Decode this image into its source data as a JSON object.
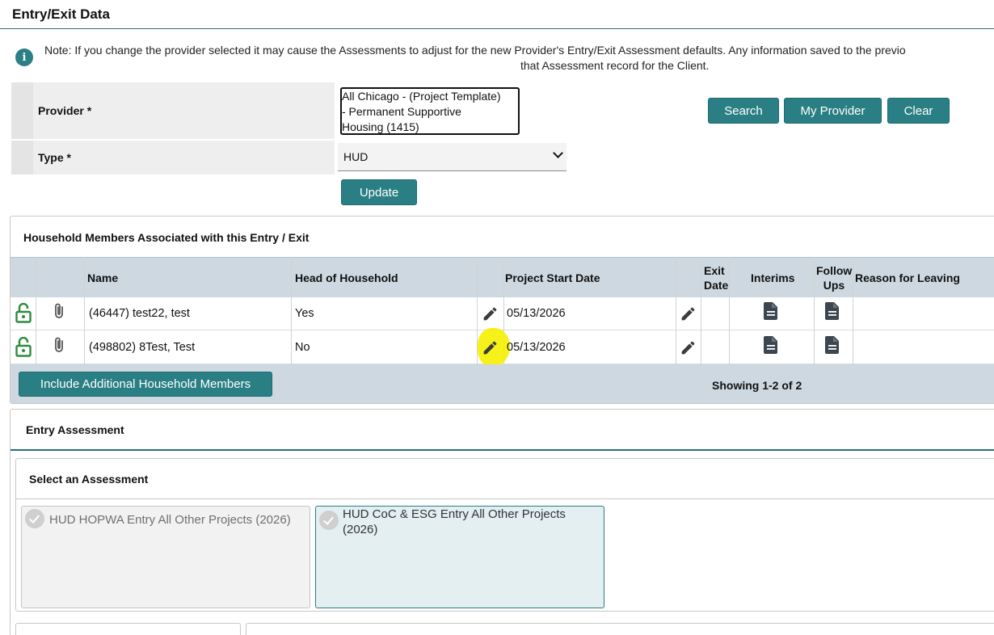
{
  "page": {
    "title": "Entry/Exit Data",
    "note_line1": "Note: If you change the provider selected it may cause the Assessments to adjust for the new Provider's Entry/Exit Assessment defaults. Any information saved to the previo",
    "note_line2": "that Assessment record for the Client.",
    "note_icon": "info-icon"
  },
  "form": {
    "provider_label": "Provider *",
    "provider_value_lines": [
      "All Chicago - (Project Template)",
      "- Permanent Supportive",
      "Housing (1415)"
    ],
    "type_label": "Type *",
    "type_value": "HUD",
    "update_label": "Update",
    "search_label": "Search",
    "my_provider_label": "My Provider",
    "clear_label": "Clear"
  },
  "household": {
    "title": "Household Members Associated with this Entry / Exit",
    "columns": {
      "name": "Name",
      "head": "Head of Household",
      "start": "Project Start Date",
      "exit_line1": "Exit",
      "exit_line2": "Date",
      "interims": "Interims",
      "follow_line1": "Follow",
      "follow_line2": "Ups",
      "reason": "Reason for Leaving"
    },
    "rows": [
      {
        "name": "(46447) test22, test",
        "head": "Yes",
        "start": "05/13/2026"
      },
      {
        "name": "(498802) 8Test, Test",
        "head": "No",
        "start": "05/13/2026"
      }
    ],
    "include_label": "Include Additional Household Members",
    "showing": "Showing 1-2 of 2"
  },
  "entry": {
    "title": "Entry Assessment",
    "select_title": "Select an Assessment",
    "cards": [
      {
        "label_line1": "HUD HOPWA Entry All Other Projects (2026)",
        "label_line2": "",
        "selected": false
      },
      {
        "label_line1": "HUD CoC & ESG Entry All Other Projects",
        "label_line2": "(2026)",
        "selected": true
      }
    ]
  },
  "colors": {
    "accent": "#2a7f85",
    "table_header": "#cdd8e0",
    "unlock_icon": "#2e8b3e",
    "highlight": "#f5f000"
  }
}
